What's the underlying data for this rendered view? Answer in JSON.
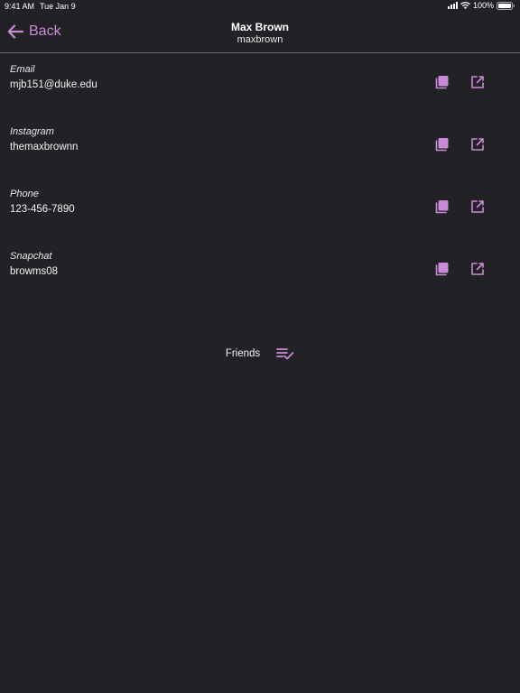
{
  "status_bar": {
    "time": "9:41 AM",
    "date": "Tue Jan 9",
    "battery": "100%"
  },
  "nav": {
    "back_label": "Back",
    "title": "Max Brown",
    "subtitle": "maxbrown"
  },
  "contacts": [
    {
      "label": "Email",
      "value": "mjb151@duke.edu"
    },
    {
      "label": "Instagram",
      "value": "themaxbrownn"
    },
    {
      "label": "Phone",
      "value": "123-456-7890"
    },
    {
      "label": "Snapchat",
      "value": "browms08"
    }
  ],
  "friends": {
    "label": "Friends"
  },
  "colors": {
    "background": "#222226",
    "accent": "#c98ad6",
    "divider": "#6a6a70"
  },
  "icons": {
    "back": "arrow-left-icon",
    "copy": "copy-icon",
    "open": "open-external-icon",
    "friends": "playlist-check-icon"
  }
}
